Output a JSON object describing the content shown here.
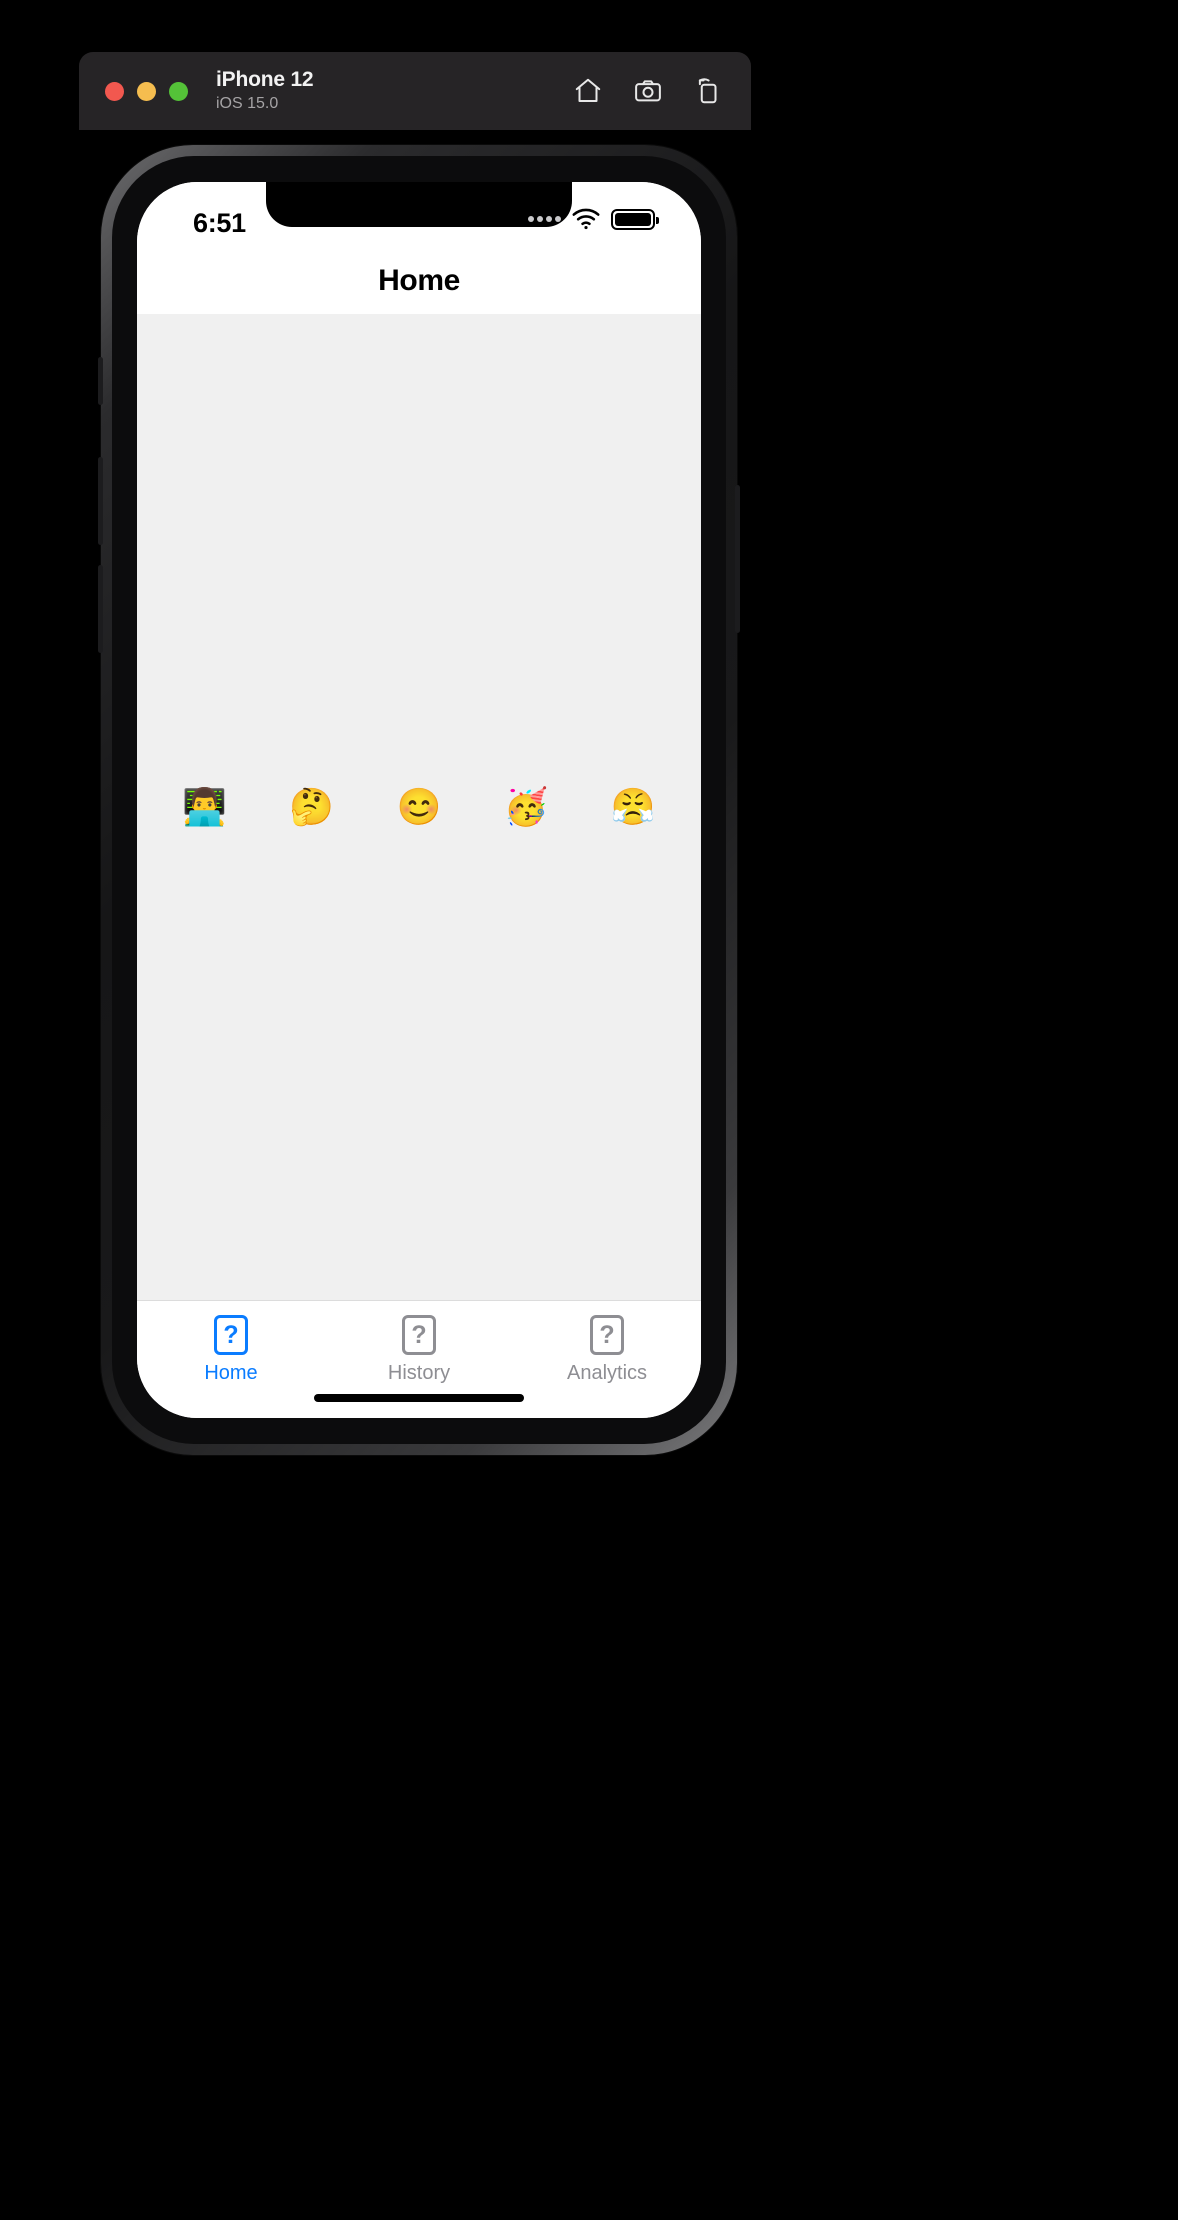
{
  "simulator": {
    "window_title": "iPhone 12",
    "window_subtitle": "iOS 15.0",
    "traffic_lights": [
      {
        "name": "close",
        "color": "#f2584f"
      },
      {
        "name": "minimize",
        "color": "#f5bd4f"
      },
      {
        "name": "maximize",
        "color": "#54c238"
      }
    ],
    "actions": [
      {
        "name": "home-icon",
        "label": "Home"
      },
      {
        "name": "screenshot-camera-icon",
        "label": "Screenshot"
      },
      {
        "name": "rotate-device-icon",
        "label": "Rotate"
      }
    ]
  },
  "status_bar": {
    "time": "6:51",
    "signal_dots": 4,
    "wifi": "wifi-icon",
    "battery_level": "100"
  },
  "nav_bar": {
    "title": "Home"
  },
  "content": {
    "emojis": [
      {
        "name": "man-technologist-emoji",
        "glyph": "👨‍💻"
      },
      {
        "name": "thinking-face-emoji",
        "glyph": "🤔"
      },
      {
        "name": "smiling-face-emoji",
        "glyph": "😊"
      },
      {
        "name": "partying-face-emoji",
        "glyph": "🥳"
      },
      {
        "name": "face-with-steam-emoji",
        "glyph": "😤"
      }
    ]
  },
  "tab_bar": {
    "active_index": 0,
    "accent_color": "#0a7cff",
    "inactive_color": "#8e8e93",
    "items": [
      {
        "name": "tab-home",
        "label": "Home",
        "glyph": "?"
      },
      {
        "name": "tab-history",
        "label": "History",
        "glyph": "?"
      },
      {
        "name": "tab-analytics",
        "label": "Analytics",
        "glyph": "?"
      }
    ]
  }
}
